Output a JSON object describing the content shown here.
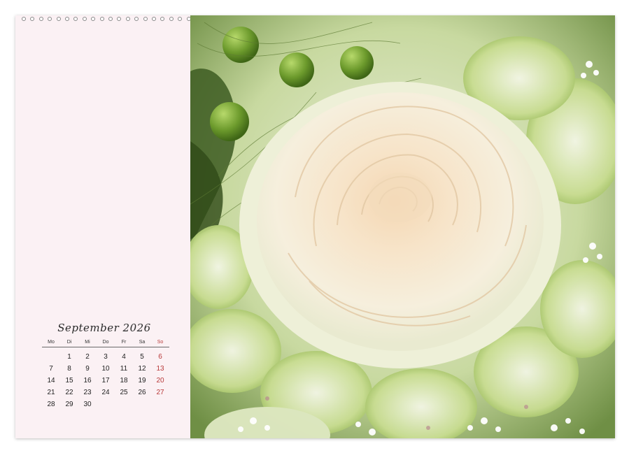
{
  "calendar": {
    "month_title": "September 2026",
    "weekdays": [
      "Mo",
      "Di",
      "Mi",
      "Do",
      "Fr",
      "Sa",
      "So"
    ],
    "weeks": [
      [
        "",
        "1",
        "2",
        "3",
        "4",
        "5",
        "6"
      ],
      [
        "7",
        "8",
        "9",
        "10",
        "11",
        "12",
        "13"
      ],
      [
        "14",
        "15",
        "16",
        "17",
        "18",
        "19",
        "20"
      ],
      [
        "21",
        "22",
        "23",
        "24",
        "25",
        "26",
        "27"
      ],
      [
        "28",
        "29",
        "30",
        "",
        "",
        "",
        ""
      ]
    ],
    "sunday_color": "#b83a3a"
  },
  "photo": {
    "subject": "rose-bouquet"
  },
  "colors": {
    "page_background": "#fbf1f4",
    "rose_cream": "#f6ead8",
    "leaf_green": "#9cbf62"
  }
}
